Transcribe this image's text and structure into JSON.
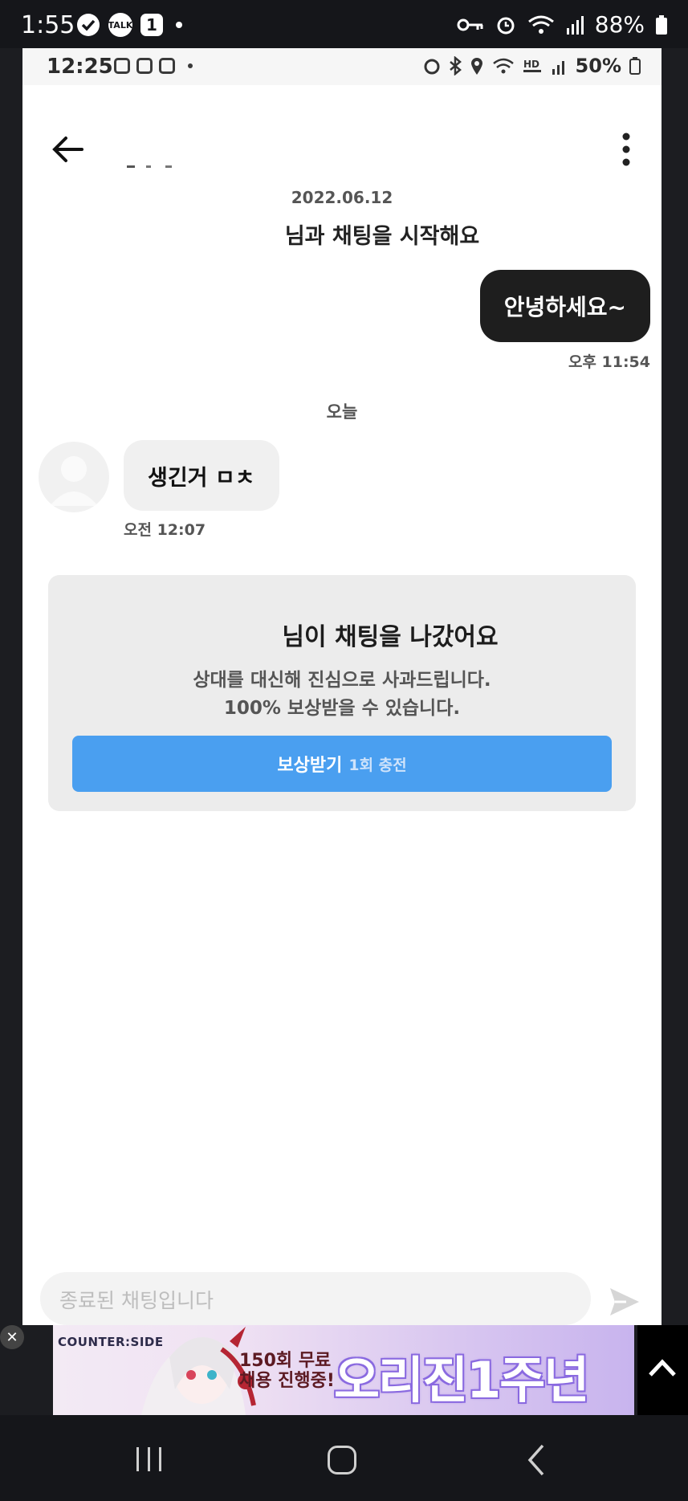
{
  "outer_status": {
    "time": "1:55",
    "talk_label": "TALK",
    "notif_count": "1",
    "battery": "88%"
  },
  "inner_status": {
    "time": "12:25",
    "battery": "50%"
  },
  "chat": {
    "date": "2022.06.12",
    "start_text": "님과 채팅을 시작해요",
    "my_message": "안녕하세요~",
    "my_time": "오후 11:54",
    "divider": "오늘",
    "their_message": "생긴거 ㅁㅊ",
    "their_time": "오전 12:07"
  },
  "notice": {
    "title": "님이 채팅을 나갔어요",
    "desc_line1": "상대를 대신해 진심으로 사과드립니다.",
    "desc_line2": "100% 보상받을 수 있습니다.",
    "button_main": "보상받기",
    "button_sub": "1회 충전"
  },
  "input": {
    "placeholder": "종료된 채팅입니다"
  },
  "ad": {
    "logo": "COUNTER:SIDE",
    "promo_line1": "150회 무료",
    "promo_line2": "채용 진행중!",
    "headline": "오리진1주년"
  },
  "colors": {
    "accent_button": "#4a9ff0",
    "my_bubble": "#1e1e1e",
    "their_bubble": "#f0f0f0"
  }
}
